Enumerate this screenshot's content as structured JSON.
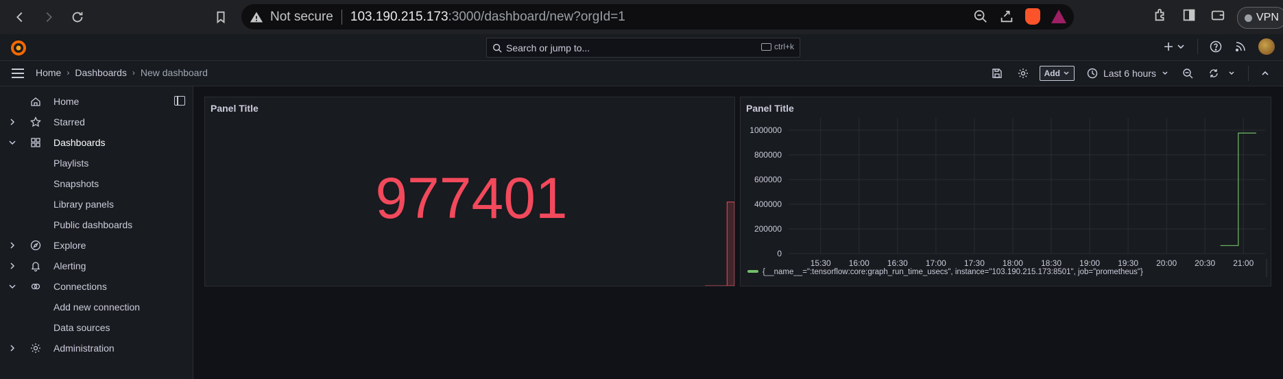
{
  "browser": {
    "url_warning": "Not secure",
    "url_host": "103.190.215.173",
    "url_rest": ":3000/dashboard/new?orgId=1",
    "vpn_label": "VPN"
  },
  "topbar": {
    "search_placeholder": "Search or jump to...",
    "search_shortcut": "ctrl+k",
    "add_icon": "plus-icon"
  },
  "breadcrumb": {
    "items": [
      "Home",
      "Dashboards",
      "New dashboard"
    ],
    "add_label": "Add",
    "time_range": "Last 6 hours"
  },
  "sidebar": {
    "items": [
      {
        "label": "Home",
        "icon": "home-icon",
        "chevron": ""
      },
      {
        "label": "Starred",
        "icon": "star-icon",
        "chevron": "right"
      },
      {
        "label": "Dashboards",
        "icon": "apps-icon",
        "chevron": "down"
      },
      {
        "label": "Playlists",
        "icon": "",
        "chevron": ""
      },
      {
        "label": "Snapshots",
        "icon": "",
        "chevron": ""
      },
      {
        "label": "Library panels",
        "icon": "",
        "chevron": ""
      },
      {
        "label": "Public dashboards",
        "icon": "",
        "chevron": ""
      },
      {
        "label": "Explore",
        "icon": "compass-icon",
        "chevron": "right"
      },
      {
        "label": "Alerting",
        "icon": "bell-icon",
        "chevron": "right"
      },
      {
        "label": "Connections",
        "icon": "connections-icon",
        "chevron": "down"
      },
      {
        "label": "Add new connection",
        "icon": "",
        "chevron": ""
      },
      {
        "label": "Data sources",
        "icon": "",
        "chevron": ""
      },
      {
        "label": "Administration",
        "icon": "cog-icon",
        "chevron": "right"
      }
    ]
  },
  "panels": {
    "stat": {
      "title": "Panel Title",
      "value": "977401",
      "value_color": "#f2495c"
    },
    "timeseries": {
      "title": "Panel Title",
      "legend": "{__name__=\":tensorflow:core:graph_run_time_usecs\", instance=\"103.190.215.173:8501\", job=\"prometheus\"}"
    }
  },
  "chart_data": [
    {
      "type": "area",
      "title": "",
      "note_values": "sparkline behind stat value",
      "x": [
        "20:45",
        "20:50",
        "20:55",
        "21:00",
        "21:05"
      ],
      "y": [
        0,
        0,
        0,
        977401,
        977401
      ],
      "color": "#f2495c",
      "ylim": [
        0,
        2200000
      ]
    },
    {
      "type": "line",
      "title": "",
      "xlabel": "",
      "ylabel": "",
      "x_ticks": [
        "15:30",
        "16:00",
        "16:30",
        "17:00",
        "17:30",
        "18:00",
        "18:30",
        "19:00",
        "19:30",
        "20:00",
        "20:30",
        "21:00"
      ],
      "y_ticks": [
        0,
        200000,
        400000,
        600000,
        800000,
        1000000
      ],
      "ylim": [
        0,
        1100000
      ],
      "series": [
        {
          "name": "{__name__=\":tensorflow:core:graph_run_time_usecs\", instance=\"103.190.215.173:8501\", job=\"prometheus\"}",
          "color": "#73bf69",
          "x": [
            "20:42",
            "20:56",
            "20:56",
            "21:10"
          ],
          "y": [
            65000,
            65000,
            977401,
            977401
          ]
        }
      ],
      "grid": true,
      "legend": "bottom"
    }
  ]
}
